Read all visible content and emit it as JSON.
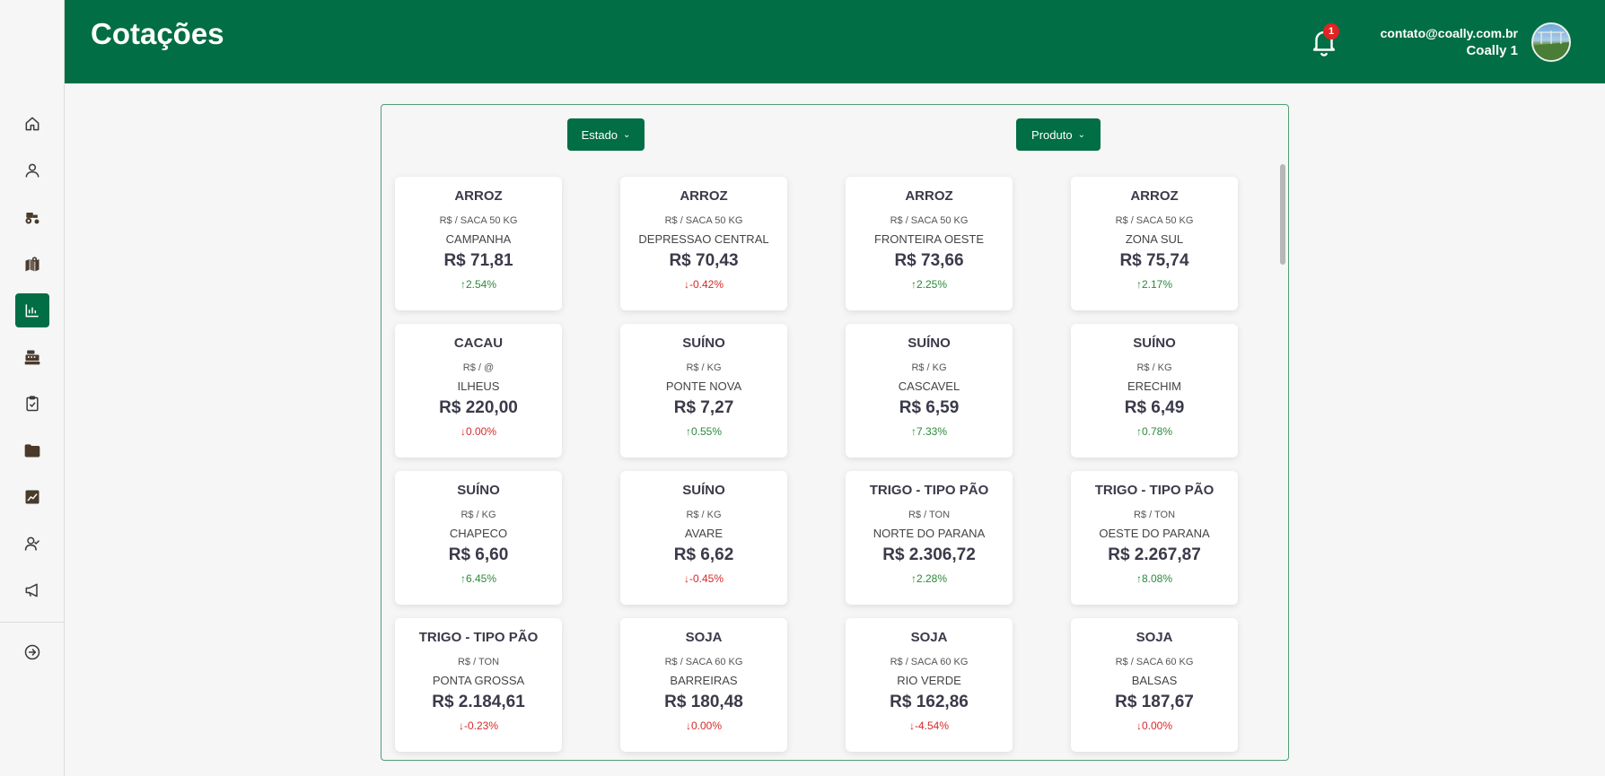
{
  "header": {
    "title": "Cotações",
    "notifications_count": "1",
    "user_email": "contato@coally.com.br",
    "user_name": "Coally 1"
  },
  "sidebar": {
    "items": [
      {
        "name": "home-icon",
        "active": false
      },
      {
        "name": "user-icon",
        "active": false
      },
      {
        "name": "tractor-icon",
        "active": false
      },
      {
        "name": "map-icon",
        "active": false
      },
      {
        "name": "chart-icon",
        "active": true
      },
      {
        "name": "cash-register-icon",
        "active": false
      },
      {
        "name": "clipboard-check-icon",
        "active": false
      },
      {
        "name": "folder-icon",
        "active": false
      },
      {
        "name": "image-chart-icon",
        "active": false
      },
      {
        "name": "users-icon",
        "active": false
      },
      {
        "name": "megaphone-icon",
        "active": false
      }
    ],
    "logout_icon": "arrow-circle-right-icon"
  },
  "filters": {
    "estado_label": "Estado",
    "produto_label": "Produto"
  },
  "colors": {
    "brand": "#016e45",
    "up": "#2a8a3a",
    "down": "#d62a2a"
  },
  "cards": [
    {
      "produto": "ARROZ",
      "unidade": "R$ / SACA 50 KG",
      "local": "CAMPANHA",
      "preco": "R$ 71,81",
      "variacao": "2.54%",
      "direcao": "up"
    },
    {
      "produto": "ARROZ",
      "unidade": "R$ / SACA 50 KG",
      "local": "DEPRESSAO CENTRAL",
      "preco": "R$ 70,43",
      "variacao": "-0.42%",
      "direcao": "down"
    },
    {
      "produto": "ARROZ",
      "unidade": "R$ / SACA 50 KG",
      "local": "FRONTEIRA OESTE",
      "preco": "R$ 73,66",
      "variacao": "2.25%",
      "direcao": "up"
    },
    {
      "produto": "ARROZ",
      "unidade": "R$ / SACA 50 KG",
      "local": "ZONA SUL",
      "preco": "R$ 75,74",
      "variacao": "2.17%",
      "direcao": "up"
    },
    {
      "produto": "CACAU",
      "unidade": "R$ / @",
      "local": "ILHEUS",
      "preco": "R$ 220,00",
      "variacao": "0.00%",
      "direcao": "down"
    },
    {
      "produto": "SUÍNO",
      "unidade": "R$ / KG",
      "local": "PONTE NOVA",
      "preco": "R$ 7,27",
      "variacao": "0.55%",
      "direcao": "up"
    },
    {
      "produto": "SUÍNO",
      "unidade": "R$ / KG",
      "local": "CASCAVEL",
      "preco": "R$ 6,59",
      "variacao": "7.33%",
      "direcao": "up"
    },
    {
      "produto": "SUÍNO",
      "unidade": "R$ / KG",
      "local": "ERECHIM",
      "preco": "R$ 6,49",
      "variacao": "0.78%",
      "direcao": "up"
    },
    {
      "produto": "SUÍNO",
      "unidade": "R$ / KG",
      "local": "CHAPECO",
      "preco": "R$ 6,60",
      "variacao": "6.45%",
      "direcao": "up"
    },
    {
      "produto": "SUÍNO",
      "unidade": "R$ / KG",
      "local": "AVARE",
      "preco": "R$ 6,62",
      "variacao": "-0.45%",
      "direcao": "down"
    },
    {
      "produto": "TRIGO - TIPO PÃO",
      "unidade": "R$ / TON",
      "local": "NORTE DO PARANA",
      "preco": "R$ 2.306,72",
      "variacao": "2.28%",
      "direcao": "up"
    },
    {
      "produto": "TRIGO - TIPO PÃO",
      "unidade": "R$ / TON",
      "local": "OESTE DO PARANA",
      "preco": "R$ 2.267,87",
      "variacao": "8.08%",
      "direcao": "up"
    },
    {
      "produto": "TRIGO - TIPO PÃO",
      "unidade": "R$ / TON",
      "local": "PONTA GROSSA",
      "preco": "R$ 2.184,61",
      "variacao": "-0.23%",
      "direcao": "down"
    },
    {
      "produto": "SOJA",
      "unidade": "R$ / SACA 60 KG",
      "local": "BARREIRAS",
      "preco": "R$ 180,48",
      "variacao": "0.00%",
      "direcao": "down"
    },
    {
      "produto": "SOJA",
      "unidade": "R$ / SACA 60 KG",
      "local": "RIO VERDE",
      "preco": "R$ 162,86",
      "variacao": "-4.54%",
      "direcao": "down"
    },
    {
      "produto": "SOJA",
      "unidade": "R$ / SACA 60 KG",
      "local": "BALSAS",
      "preco": "R$ 187,67",
      "variacao": "0.00%",
      "direcao": "down"
    }
  ]
}
